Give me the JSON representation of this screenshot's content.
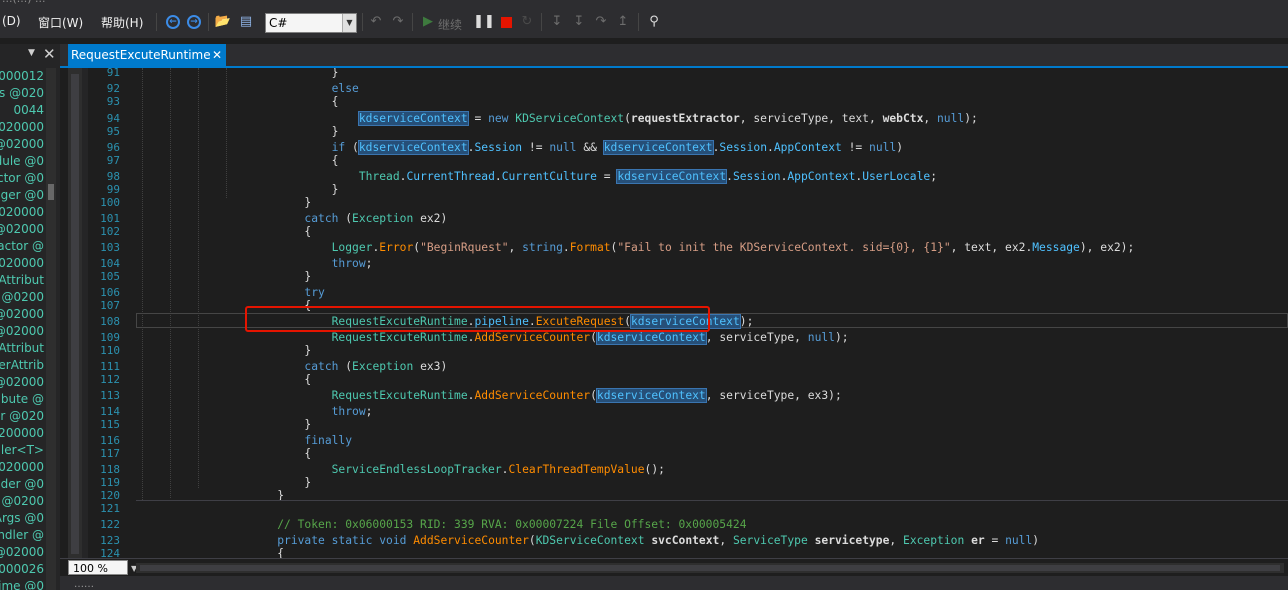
{
  "titlebar": {
    "text": "...(...) ..."
  },
  "menu": [
    {
      "label": "(D)"
    },
    {
      "label": "窗口(W)"
    },
    {
      "label": "帮助(H)"
    }
  ],
  "toolbar": {
    "language": "C#",
    "continue_label": "继续"
  },
  "left_panel": {
    "items": [
      "000012",
      "s @020",
      "0044",
      "020000",
      "@02000",
      "dule @0",
      "ctor @0",
      "gger @0",
      "020000",
      "@02000",
      "ractor @",
      "020000",
      "Attribut",
      "r @0200",
      "@02000",
      "@02000",
      "Attribut",
      "erAttrib",
      "@02000",
      "ibute @",
      "er @020",
      "0200000",
      "dler<T>",
      "020000",
      "lder @0",
      "r @0200",
      "Args @0",
      "ndler @",
      "@02000",
      "000026",
      "time @0"
    ]
  },
  "editor": {
    "tab_label": "RequestExcuteRuntime",
    "zoom": "100 %",
    "lines": [
      {
        "n": "91",
        "code": [
          [
            "            }",
            "p"
          ]
        ]
      },
      {
        "n": "92",
        "code": [
          [
            "            ",
            "p"
          ],
          [
            "else",
            "k"
          ]
        ]
      },
      {
        "n": "93",
        "code": [
          [
            "            {",
            "p"
          ]
        ]
      },
      {
        "n": "94",
        "code": [
          [
            "                ",
            "p"
          ],
          [
            "kdserviceContext",
            "h"
          ],
          [
            " = ",
            "p"
          ],
          [
            "new ",
            "k"
          ],
          [
            "KDServiceContext",
            "t"
          ],
          [
            "(",
            "p"
          ],
          [
            "requestExtractor",
            "b"
          ],
          [
            ", serviceType, text, ",
            "p"
          ],
          [
            "webCtx",
            "b"
          ],
          [
            ", ",
            "p"
          ],
          [
            "null",
            "k"
          ],
          [
            ");",
            "p"
          ]
        ]
      },
      {
        "n": "95",
        "code": [
          [
            "            }",
            "p"
          ]
        ]
      },
      {
        "n": "96",
        "code": [
          [
            "            ",
            "p"
          ],
          [
            "if",
            "k"
          ],
          [
            " (",
            "p"
          ],
          [
            "kdserviceContext",
            "h"
          ],
          [
            ".",
            "p"
          ],
          [
            "Session",
            "m"
          ],
          [
            " != ",
            "p"
          ],
          [
            "null",
            "k"
          ],
          [
            " && ",
            "p"
          ],
          [
            "kdserviceContext",
            "h"
          ],
          [
            ".",
            "p"
          ],
          [
            "Session",
            "m"
          ],
          [
            ".",
            "p"
          ],
          [
            "AppContext",
            "m"
          ],
          [
            " != ",
            "p"
          ],
          [
            "null",
            "k"
          ],
          [
            ")",
            "p"
          ]
        ]
      },
      {
        "n": "97",
        "code": [
          [
            "            {",
            "p"
          ]
        ]
      },
      {
        "n": "98",
        "code": [
          [
            "                ",
            "p"
          ],
          [
            "Thread",
            "t"
          ],
          [
            ".",
            "p"
          ],
          [
            "CurrentThread",
            "m"
          ],
          [
            ".",
            "p"
          ],
          [
            "CurrentCulture",
            "m"
          ],
          [
            " = ",
            "p"
          ],
          [
            "kdserviceContext",
            "h"
          ],
          [
            ".",
            "p"
          ],
          [
            "Session",
            "m"
          ],
          [
            ".",
            "p"
          ],
          [
            "AppContext",
            "m"
          ],
          [
            ".",
            "p"
          ],
          [
            "UserLocale",
            "m"
          ],
          [
            ";",
            "p"
          ]
        ]
      },
      {
        "n": "99",
        "code": [
          [
            "            }",
            "p"
          ]
        ]
      },
      {
        "n": "100",
        "code": [
          [
            "        }",
            "p"
          ]
        ]
      },
      {
        "n": "101",
        "code": [
          [
            "        ",
            "p"
          ],
          [
            "catch",
            "k"
          ],
          [
            " (",
            "p"
          ],
          [
            "Exception",
            "t"
          ],
          [
            " ex2)",
            "p"
          ]
        ]
      },
      {
        "n": "102",
        "code": [
          [
            "        {",
            "p"
          ]
        ]
      },
      {
        "n": "103",
        "code": [
          [
            "            ",
            "p"
          ],
          [
            "Logger",
            "t"
          ],
          [
            ".",
            "p"
          ],
          [
            "Error",
            "f"
          ],
          [
            "(",
            "p"
          ],
          [
            "\"BeginRquest\"",
            "s"
          ],
          [
            ", ",
            "p"
          ],
          [
            "string",
            "k"
          ],
          [
            ".",
            "p"
          ],
          [
            "Format",
            "f"
          ],
          [
            "(",
            "p"
          ],
          [
            "\"Fail to init the KDServiceContext. sid={0}, {1}\"",
            "s"
          ],
          [
            ", text, ex2.",
            "p"
          ],
          [
            "Message",
            "m"
          ],
          [
            "), ex2);",
            "p"
          ]
        ]
      },
      {
        "n": "104",
        "code": [
          [
            "            ",
            "p"
          ],
          [
            "throw",
            "k"
          ],
          [
            ";",
            "p"
          ]
        ]
      },
      {
        "n": "105",
        "code": [
          [
            "        }",
            "p"
          ]
        ]
      },
      {
        "n": "106",
        "code": [
          [
            "        ",
            "p"
          ],
          [
            "try",
            "k"
          ]
        ]
      },
      {
        "n": "107",
        "code": [
          [
            "        {",
            "p"
          ]
        ]
      },
      {
        "n": "108",
        "code": [
          [
            "            ",
            "p"
          ],
          [
            "RequestExcuteRuntime",
            "t"
          ],
          [
            ".",
            "p"
          ],
          [
            "pipeline",
            "m"
          ],
          [
            ".",
            "p"
          ],
          [
            "ExcuteRequest",
            "f"
          ],
          [
            "(",
            "p"
          ],
          [
            "kdserviceContext",
            "h"
          ],
          [
            ");",
            "p"
          ]
        ]
      },
      {
        "n": "109",
        "code": [
          [
            "            ",
            "p"
          ],
          [
            "RequestExcuteRuntime",
            "t"
          ],
          [
            ".",
            "p"
          ],
          [
            "AddServiceCounter",
            "f"
          ],
          [
            "(",
            "p"
          ],
          [
            "kdserviceContext",
            "h"
          ],
          [
            ", serviceType, ",
            "p"
          ],
          [
            "null",
            "k"
          ],
          [
            ");",
            "p"
          ]
        ]
      },
      {
        "n": "110",
        "code": [
          [
            "        }",
            "p"
          ]
        ]
      },
      {
        "n": "111",
        "code": [
          [
            "        ",
            "p"
          ],
          [
            "catch",
            "k"
          ],
          [
            " (",
            "p"
          ],
          [
            "Exception",
            "t"
          ],
          [
            " ex3)",
            "p"
          ]
        ]
      },
      {
        "n": "112",
        "code": [
          [
            "        {",
            "p"
          ]
        ]
      },
      {
        "n": "113",
        "code": [
          [
            "            ",
            "p"
          ],
          [
            "RequestExcuteRuntime",
            "t"
          ],
          [
            ".",
            "p"
          ],
          [
            "AddServiceCounter",
            "f"
          ],
          [
            "(",
            "p"
          ],
          [
            "kdserviceContext",
            "h"
          ],
          [
            ", serviceType, ex3);",
            "p"
          ]
        ]
      },
      {
        "n": "114",
        "code": [
          [
            "            ",
            "p"
          ],
          [
            "throw",
            "k"
          ],
          [
            ";",
            "p"
          ]
        ]
      },
      {
        "n": "115",
        "code": [
          [
            "        }",
            "p"
          ]
        ]
      },
      {
        "n": "116",
        "code": [
          [
            "        ",
            "p"
          ],
          [
            "finally",
            "k"
          ]
        ]
      },
      {
        "n": "117",
        "code": [
          [
            "        {",
            "p"
          ]
        ]
      },
      {
        "n": "118",
        "code": [
          [
            "            ",
            "p"
          ],
          [
            "ServiceEndlessLoopTracker",
            "t"
          ],
          [
            ".",
            "p"
          ],
          [
            "ClearThreadTempValue",
            "f"
          ],
          [
            "();",
            "p"
          ]
        ]
      },
      {
        "n": "119",
        "code": [
          [
            "        }",
            "p"
          ]
        ]
      },
      {
        "n": "120",
        "code": [
          [
            "    }",
            "p"
          ]
        ]
      },
      {
        "n": "121",
        "code": []
      },
      {
        "n": "122",
        "code": [
          [
            "    // Token: 0x06000153 RID: 339 RVA: 0x00007224 File Offset: 0x00005424",
            "c"
          ]
        ]
      },
      {
        "n": "123",
        "code": [
          [
            "    ",
            "p"
          ],
          [
            "private static void ",
            "k"
          ],
          [
            "AddServiceCounter",
            "f"
          ],
          [
            "(",
            "p"
          ],
          [
            "KDServiceContext",
            "t"
          ],
          [
            " ",
            "p"
          ],
          [
            "svcContext",
            "b"
          ],
          [
            ", ",
            "p"
          ],
          [
            "ServiceType",
            "t"
          ],
          [
            " ",
            "p"
          ],
          [
            "servicetype",
            "b"
          ],
          [
            ", ",
            "p"
          ],
          [
            "Exception",
            "t"
          ],
          [
            " ",
            "p"
          ],
          [
            "er",
            "b"
          ],
          [
            " = ",
            "p"
          ],
          [
            "null",
            "k"
          ],
          [
            ")",
            "p"
          ]
        ]
      },
      {
        "n": "124",
        "code": [
          [
            "    {",
            "p"
          ]
        ]
      }
    ]
  },
  "colors": {
    "keyword": "#569cd6",
    "type": "#4ec9b0",
    "member": "#4fc1ff",
    "method": "#ff8c00",
    "string": "#d69d85",
    "comment": "#57a64a",
    "plain": "#dcdcdc",
    "accent": "#007acc",
    "highlight_box": "#e51400"
  },
  "bottom": {
    "text": "……"
  }
}
